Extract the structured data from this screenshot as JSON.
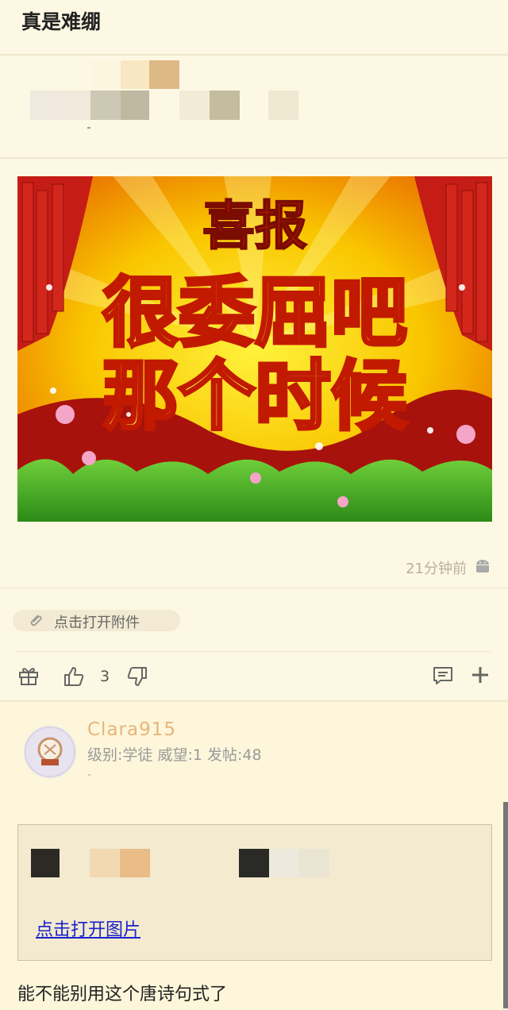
{
  "header": {
    "title": "真是难绷"
  },
  "post": {
    "poster_image": {
      "headline": "喜报",
      "line1": "很委屈吧",
      "line2": "那个时候",
      "colors": {
        "bg": "#f7b800",
        "text": "#fff45a",
        "text_stroke": "#c11a00",
        "curtain": "#c51d15"
      }
    },
    "timestamp": "21分钟前",
    "platform_icon": "android-icon",
    "attachment_label": "点击打开附件",
    "actions": {
      "like_count": "3"
    }
  },
  "reply": {
    "username": "Clara915",
    "user_stats": "级别:学徒 威望:1 发帖:48",
    "dash": "-",
    "quote_link": "点击打开图片",
    "text": "能不能别用这个唐诗句式了"
  }
}
